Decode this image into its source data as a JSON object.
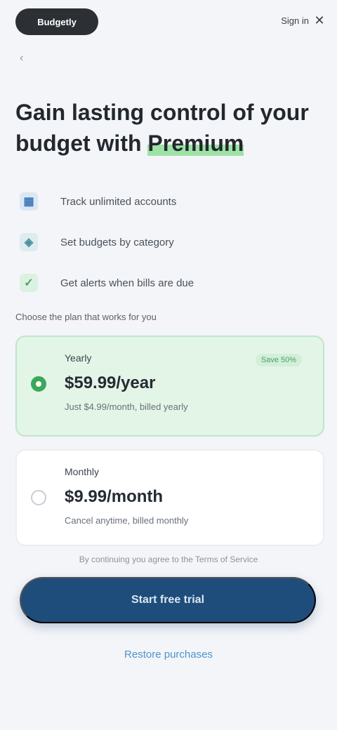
{
  "header": {
    "brand": "Budgetly",
    "signin_label": "Sign in",
    "close_icon": "close-icon"
  },
  "back_icon": "chevron-left-icon",
  "headline": {
    "part1": "Gain lasting control of your",
    "part2": "budget with",
    "highlight": "Premium"
  },
  "features": [
    {
      "icon": "chart-icon",
      "text": "Track unlimited accounts"
    },
    {
      "icon": "shield-icon",
      "text": "Set budgets by category"
    },
    {
      "icon": "check-icon",
      "text": "Get alerts when bills are due"
    }
  ],
  "plans_label": "Choose the plan that works for you",
  "plans": [
    {
      "name": "Yearly",
      "price": "$59.99/year",
      "note": "Just $4.99/month, billed yearly",
      "badge": "Save 50%",
      "selected": true
    },
    {
      "name": "Monthly",
      "price": "$9.99/month",
      "note": "Cancel anytime, billed monthly",
      "selected": false
    }
  ],
  "terms": "By continuing you agree to the Terms of Service",
  "cta_label": "Start free trial",
  "secondary_link": "Restore purchases",
  "colors": {
    "accent": "#1e4d7c",
    "highlight": "#9ee2a6",
    "selected_plan_bg": "#e3f5e7",
    "link": "#4f93d0"
  }
}
